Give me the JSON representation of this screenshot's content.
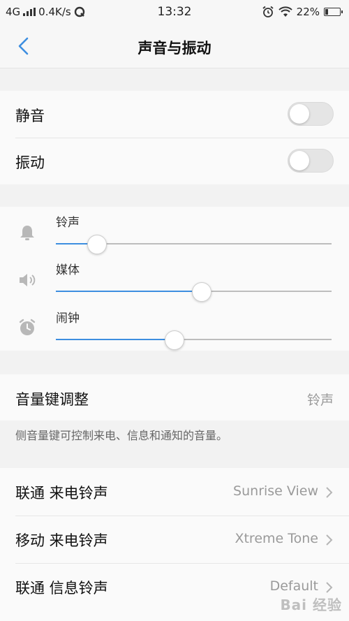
{
  "status_bar": {
    "network": "4G",
    "speed": "0.4K/s",
    "time": "13:32",
    "battery": "22%",
    "battery_level": 0.22
  },
  "header": {
    "title": "声音与振动"
  },
  "toggles": {
    "mute": {
      "label": "静音",
      "on": false
    },
    "vibrate": {
      "label": "振动",
      "on": false
    }
  },
  "volumes": [
    {
      "label": "铃声",
      "icon": "bell-icon",
      "level": 0.15
    },
    {
      "label": "媒体",
      "icon": "speaker-icon",
      "level": 0.53
    },
    {
      "label": "闹钟",
      "icon": "alarm-clock-icon",
      "level": 0.43
    }
  ],
  "volume_key": {
    "label": "音量键调整",
    "value": "铃声",
    "note": "侧音量键可控制来电、信息和通知的音量。"
  },
  "ringtones": [
    {
      "label": "联通 来电铃声",
      "value": "Sunrise View"
    },
    {
      "label": "移动 来电铃声",
      "value": "Xtreme Tone"
    },
    {
      "label": "联通 信息铃声",
      "value": "Default"
    }
  ],
  "watermark": "Bai 经验",
  "colors": {
    "accent": "#3d8ee0",
    "back_arrow": "#3d8ee0",
    "toggle_off": "#e5e5e5"
  }
}
